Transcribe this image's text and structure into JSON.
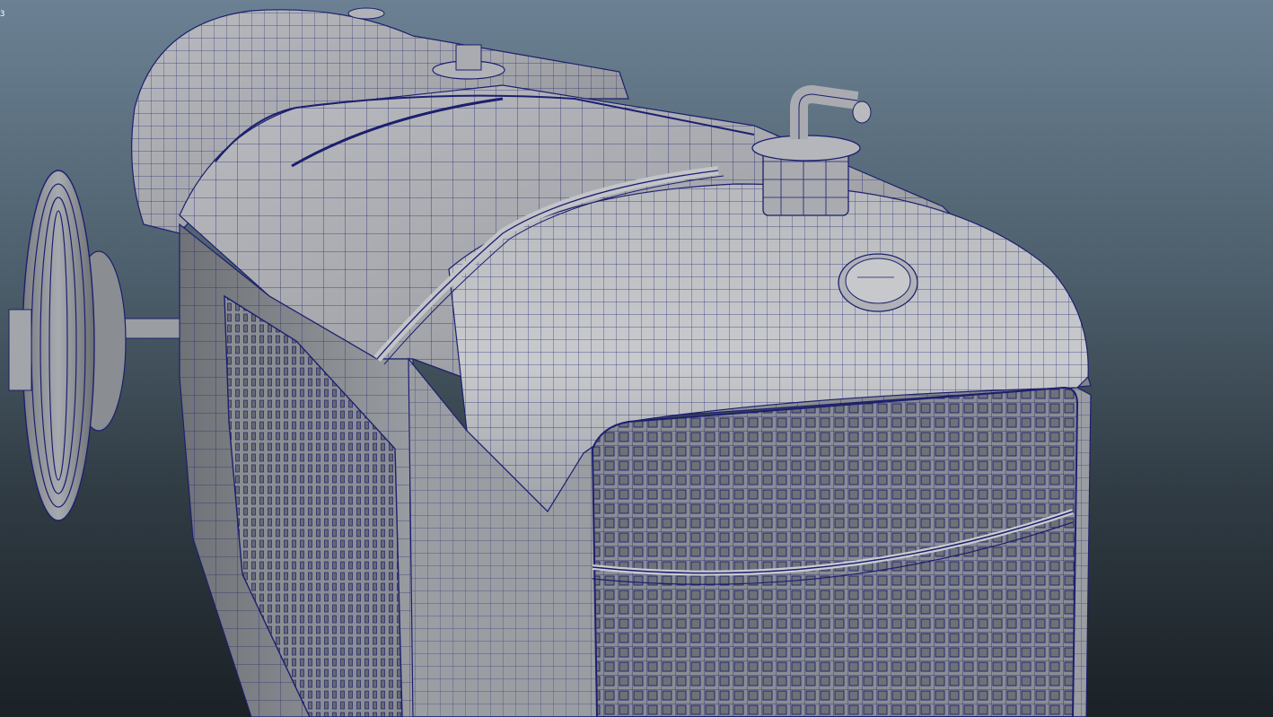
{
  "viewport": {
    "corner_glyph": "3",
    "wire_color": "#1c1f6e",
    "surface_color": "#a9abb0",
    "surface_highlight": "#c9cbcf",
    "surface_shadow": "#6e7176",
    "background_top": "#6b8193",
    "background_bottom": "#1b2126"
  },
  "scene": {
    "model": "vintage-racecar-wireframe",
    "display_mode": "wireframe-on-shaded"
  }
}
